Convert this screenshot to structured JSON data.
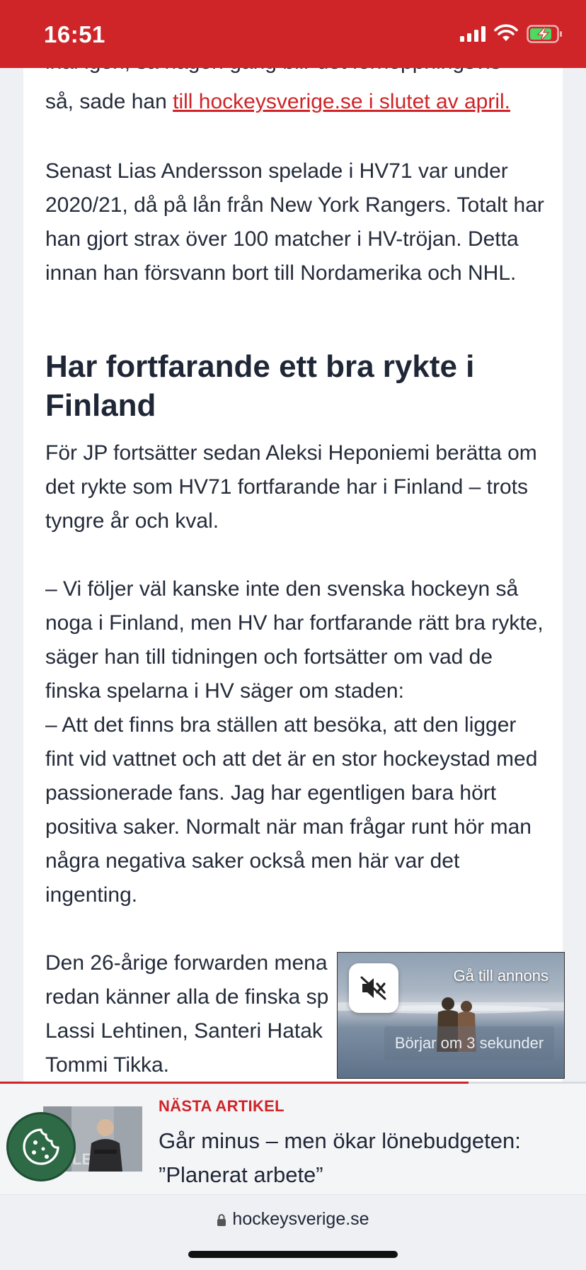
{
  "status_bar": {
    "time": "16:51"
  },
  "article": {
    "partial_top_line": "inal igen, så någon gång blir det förhoppningsvis",
    "para1_prefix": "så, sade han ",
    "para1_link": "till hockeysverige.se i slutet av april.",
    "para2": "Senast Lias Andersson spelade i HV71 var under 2020/21, då på lån från New York Rangers. Totalt har han gjort strax över 100 matcher i HV-tröjan. Detta innan han försvann bort till Nordamerika och NHL.",
    "heading": "Har fortfarande ett bra rykte i Finland",
    "para3": "För JP fortsätter sedan Aleksi Heponiemi berätta om det rykte som HV71 fortfarande har i Finland – trots tyngre år och kval.",
    "para4": "– Vi följer väl kanske inte den svenska hockeyn så noga i Finland, men HV har fortfarande rätt bra rykte, säger han till tidningen och fortsätter om vad de finska spelarna i HV säger om staden:",
    "para5": "– Att det finns bra ställen att besöka, att den ligger fint vid vattnet och att det är en stor hockeystad med passionerade fans. Jag har egentligen bara hört positiva saker. Normalt när man frågar runt hör man några negativa saker också men här var det ingenting.",
    "para6_lines": [
      "Den 26-årige forwarden mena",
      "redan känner alla de finska sp",
      "Lassi Lehtinen, Santeri Hatak",
      "Tommi Tikka."
    ]
  },
  "ad": {
    "cta": "Gå till annons",
    "countdown": "Börjar om 3 sekunder",
    "mute_icon": "speaker-muted-icon"
  },
  "next_article": {
    "label": "NÄSTA ARTIKEL",
    "title": "Går minus – men ökar lönebudgeten: ”Planerat arbete”",
    "progress": 0.8
  },
  "browser": {
    "url": "hockeysverige.se"
  },
  "colors": {
    "brand_red": "#cf2428",
    "cookie_green": "#2e6a45",
    "text": "#242b3a"
  }
}
